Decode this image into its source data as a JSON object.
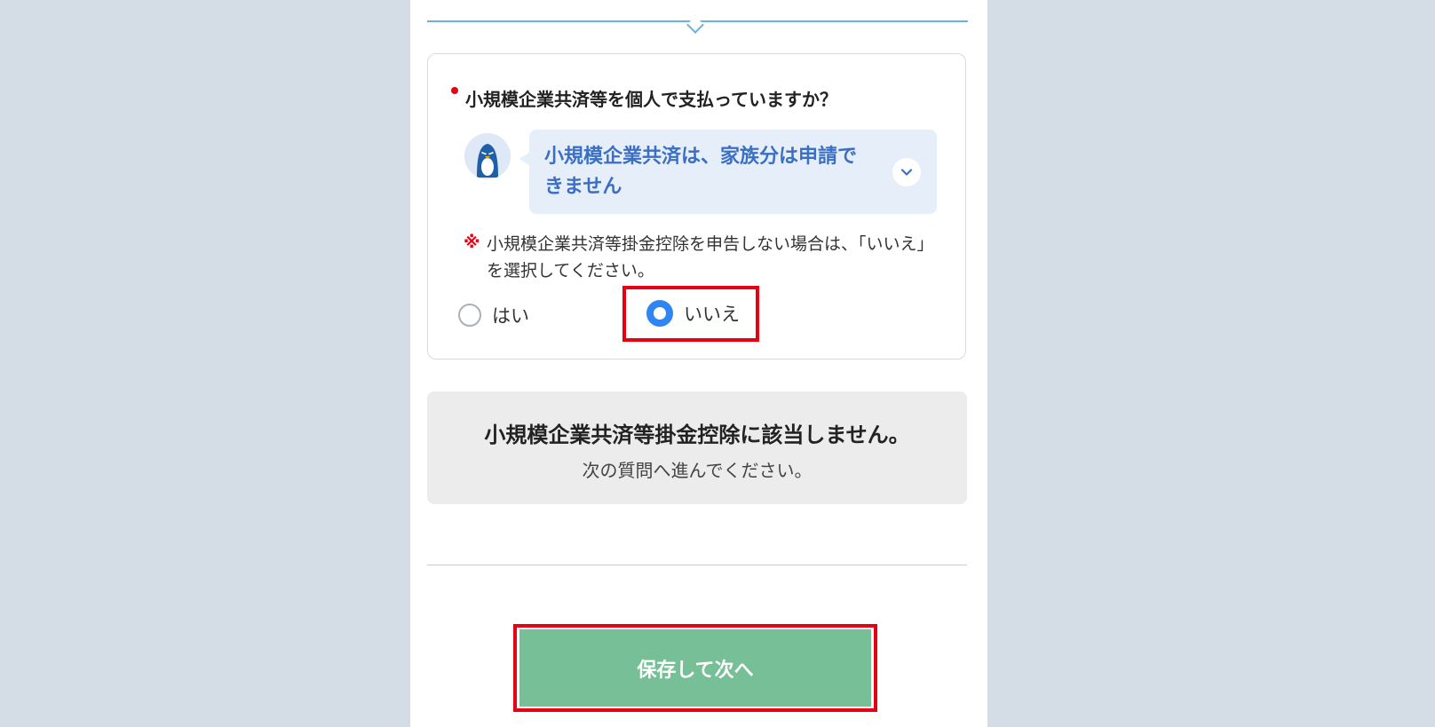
{
  "question": {
    "title": "小規模企業共済等を個人で支払っていますか？",
    "hint": "小規模企業共済は、家族分は申請できません",
    "note_mark": "※",
    "note": "小規模企業共済等掛金控除を申告しない場合は、「いいえ」を選択してください。",
    "options": [
      {
        "label": "はい",
        "selected": false
      },
      {
        "label": "いいえ",
        "selected": true
      }
    ]
  },
  "result": {
    "title": "小規模企業共済等掛金控除に該当しません。",
    "subtitle": "次の質問へ進んでください。"
  },
  "footer": {
    "save_label": "保存して次へ"
  },
  "colors": {
    "accent_blue": "#2f86f0",
    "hint_text": "#3a6fc4",
    "required": "#e60012",
    "save_button": "#77bf97",
    "highlight": "#e60012"
  },
  "icons": {
    "avatar": "penguin-mascot-icon",
    "expand": "chevron-down-icon"
  }
}
